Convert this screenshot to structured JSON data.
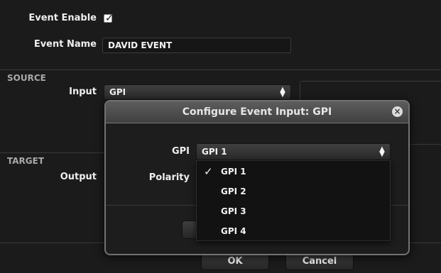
{
  "event_enable": {
    "label": "Event Enable",
    "checked": true,
    "check_glyph": "✓"
  },
  "event_name": {
    "label": "Event Name",
    "value": "DAVID EVENT"
  },
  "source": {
    "section_label": "SOURCE",
    "input_label": "Input",
    "input_value": "GPI"
  },
  "target": {
    "section_label": "TARGET",
    "output_label": "Output"
  },
  "dialog": {
    "title": "Configure Event Input: GPI",
    "close_icon": "×",
    "gpi_label": "GPI",
    "gpi_value": "GPI 1",
    "polarity_label": "Polarity",
    "gpi_options": [
      {
        "label": "GPI 1",
        "selected": true,
        "mark": "✓"
      },
      {
        "label": "GPI 2",
        "selected": false
      },
      {
        "label": "GPI 3",
        "selected": false
      },
      {
        "label": "GPI 4",
        "selected": false
      }
    ]
  },
  "footer": {
    "ok_label": "OK",
    "cancel_label": "Cancel"
  },
  "icons": {
    "updown": "updown-arrows-icon",
    "check": "checkmark-icon",
    "close": "close-circle-icon"
  },
  "colors": {
    "background": "#1b1b1b",
    "dialog_border": "#727272",
    "field_bg": "#161616"
  }
}
